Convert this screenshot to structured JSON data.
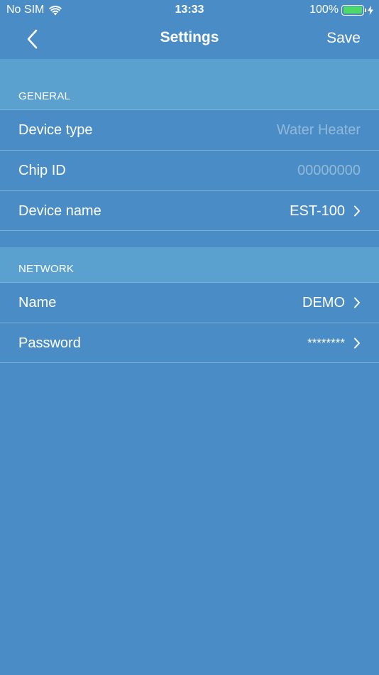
{
  "status_bar": {
    "carrier": "No SIM",
    "time": "13:33",
    "battery_percent": "100%",
    "battery_level": 1.0,
    "battery_color": "#4cd964"
  },
  "nav": {
    "title": "Settings",
    "save_label": "Save",
    "back_icon": "chevron-left-icon"
  },
  "general": {
    "header": "GENERAL",
    "rows": [
      {
        "label": "Device type",
        "value": "Water Heater",
        "disclosure": false
      },
      {
        "label": "Chip ID",
        "value": "00000000",
        "disclosure": false
      },
      {
        "label": "Device name",
        "value": "EST-100",
        "disclosure": true
      }
    ]
  },
  "network": {
    "header": "NETWORK",
    "rows": [
      {
        "label": "Name",
        "value": "DEMO",
        "disclosure": true
      },
      {
        "label": "Password",
        "value": "********",
        "disclosure": true
      }
    ]
  },
  "colors": {
    "background": "#4a8dc6",
    "section_header": "#5aa1d0",
    "muted_value": "#92b8d8"
  }
}
